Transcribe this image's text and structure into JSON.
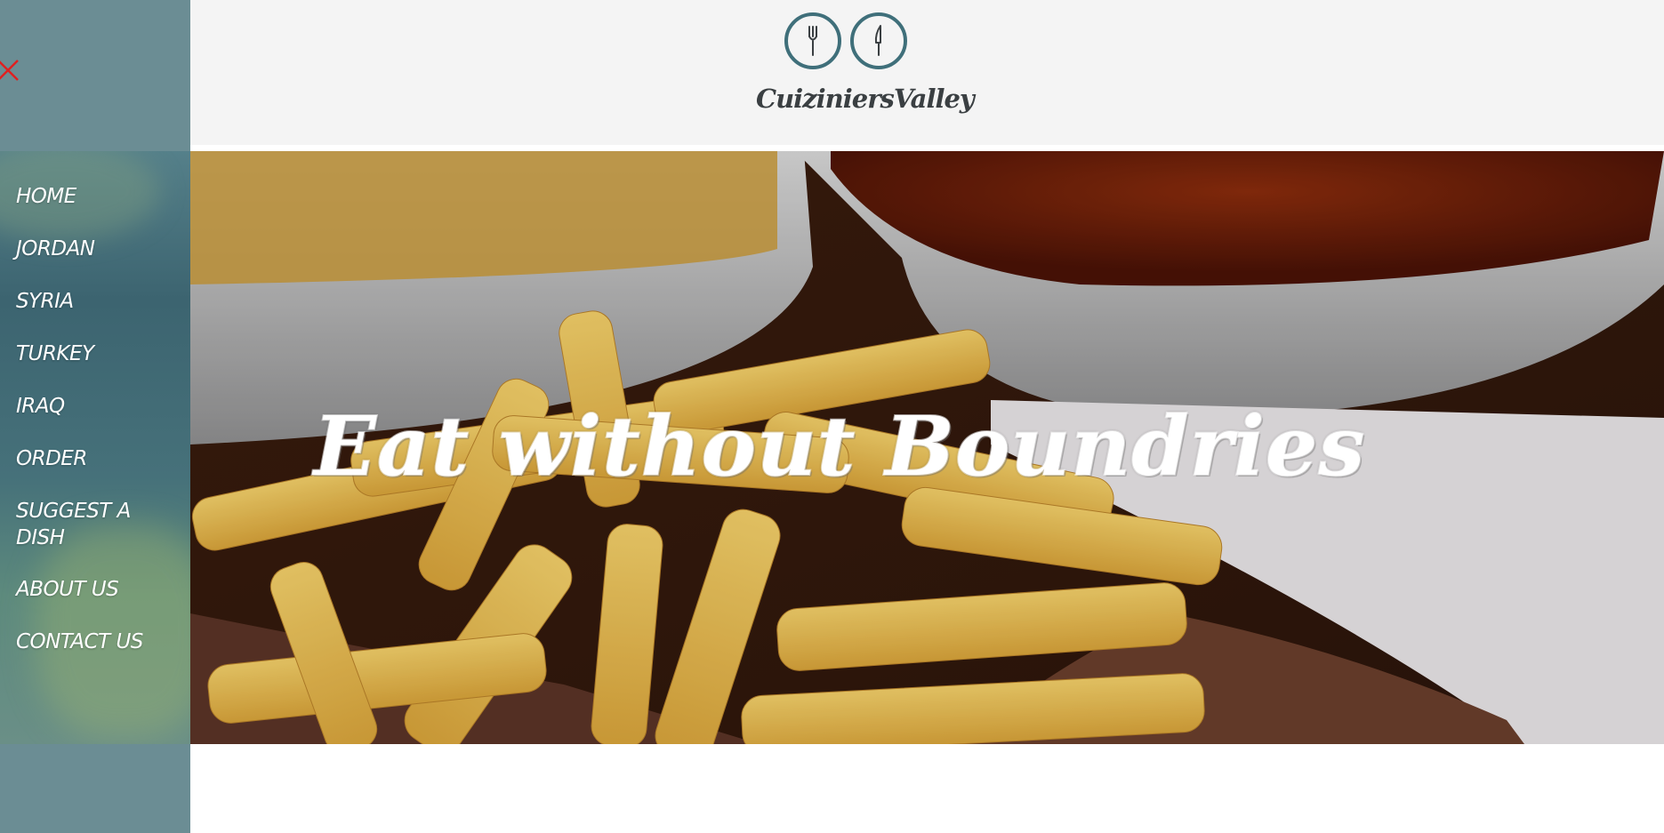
{
  "brand": {
    "name": "CuiziniersValley"
  },
  "hero": {
    "title": "Eat without Boundries"
  },
  "sidebar": {
    "close_icon": "close-icon",
    "items": [
      {
        "label": "HOME"
      },
      {
        "label": "JORDAN"
      },
      {
        "label": "SYRIA"
      },
      {
        "label": "TURKEY"
      },
      {
        "label": "IRAQ"
      },
      {
        "label": "ORDER"
      },
      {
        "label": "SUGGEST A DISH"
      },
      {
        "label": "ABOUT US"
      },
      {
        "label": "CONTACT US"
      }
    ]
  },
  "colors": {
    "sidebar": "#6b8d94",
    "logo_accent": "#3f6f7a",
    "close": "#e02020",
    "header_bg": "#f4f4f4"
  }
}
